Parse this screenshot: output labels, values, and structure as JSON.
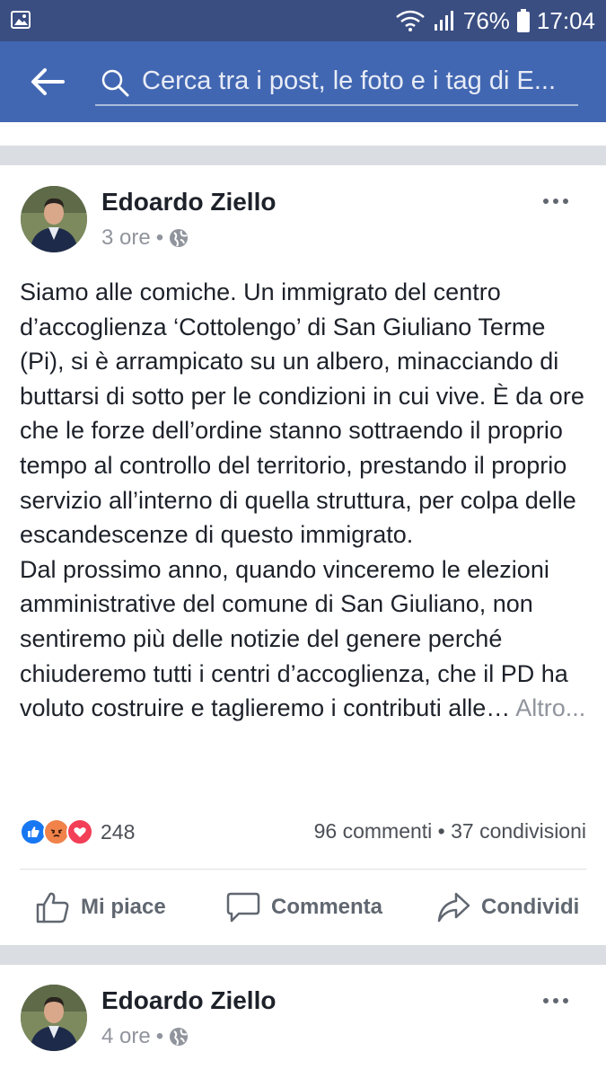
{
  "status_bar": {
    "battery": "76%",
    "time": "17:04"
  },
  "search": {
    "placeholder": "Cerca tra i post, le foto e i tag di E..."
  },
  "posts": [
    {
      "author": "Edoardo Ziello",
      "time": "3 ore",
      "body": [
        "Siamo alle comiche. Un immigrato del centro d’accoglienza ‘Cottolengo’ di San Giuliano Terme (Pi), si è arrampicato su un albero, minacciando di buttarsi di sotto per le condizioni in cui vive. È da ore che le forze dell’ordine stanno sottraendo il proprio tempo al controllo del territorio, prestando il proprio servizio all’interno di quella struttura, per colpa delle escandescenze di questo immigrato.",
        "Dal prossimo anno, quando vinceremo le elezioni amministrative del comune di San Giuliano, non sentiremo più delle notizie del genere perché chiuderemo tutti i centri d’accoglienza, che il PD ha voluto costruire e taglieremo i contributi alle…"
      ],
      "more_link": "Altro...",
      "reaction_count": "248",
      "comments": "96 commenti",
      "shares": "37 condivisioni",
      "stats_separator": "•"
    },
    {
      "author": "Edoardo Ziello",
      "time": "4 ore"
    }
  ],
  "actions": {
    "like": "Mi piace",
    "comment": "Commenta",
    "share": "Condividi"
  },
  "meta_separator": "•",
  "colors": {
    "status_bar": "#3a4e82",
    "app_bar": "#4267b2",
    "like_blue": "#1877f2",
    "angry_orange": "#f0824a",
    "love_red": "#f33e58"
  }
}
